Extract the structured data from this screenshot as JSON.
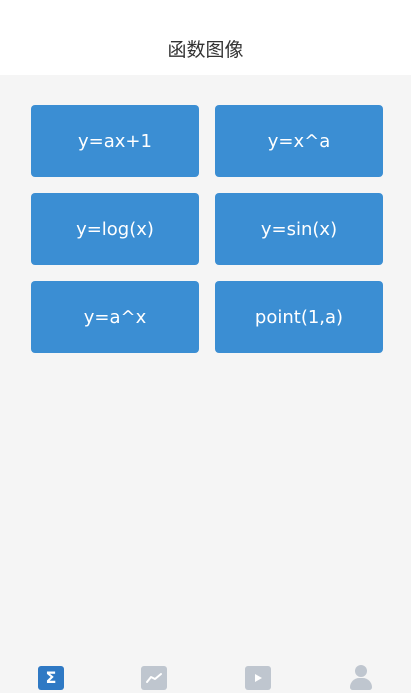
{
  "header": {
    "title": "函数图像"
  },
  "buttons": [
    {
      "label": "y=ax+1"
    },
    {
      "label": "y=x^a"
    },
    {
      "label": "y=log(x)"
    },
    {
      "label": "y=sin(x)"
    },
    {
      "label": "y=a^x"
    },
    {
      "label": "point(1,a)"
    }
  ],
  "tabbar": {
    "items": [
      {
        "icon": "sigma-icon",
        "active": true,
        "color": "#2f79c4"
      },
      {
        "icon": "line-chart-icon",
        "active": false,
        "color": "#bfc6cf"
      },
      {
        "icon": "video-play-icon",
        "active": false,
        "color": "#bfc6cf"
      },
      {
        "icon": "profile-icon",
        "active": false,
        "color": "#bfc6cf"
      }
    ]
  },
  "colors": {
    "background": "#f5f5f5",
    "header_background": "#ffffff",
    "button_background": "#3b8ed3",
    "button_text": "#ffffff"
  }
}
